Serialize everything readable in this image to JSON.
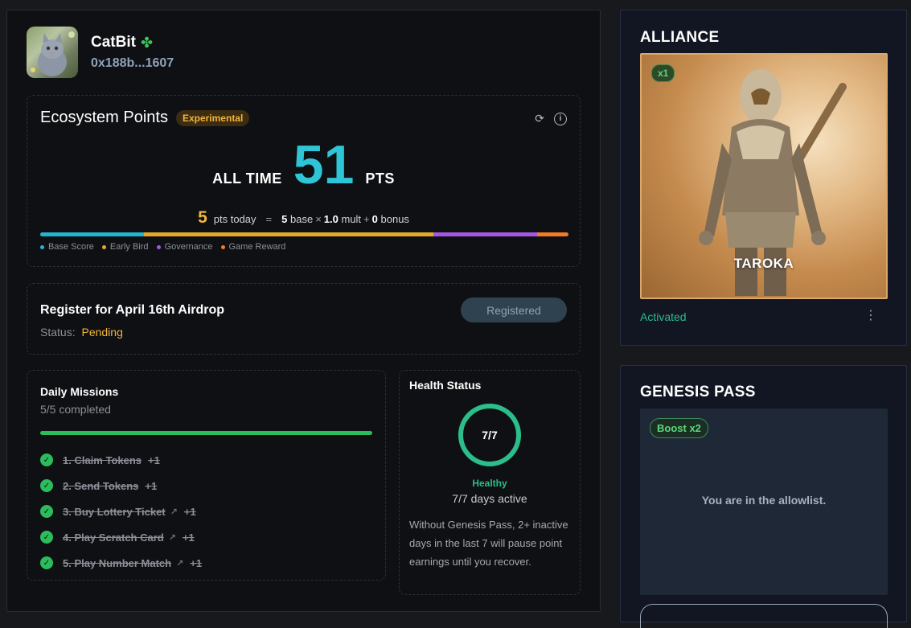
{
  "profile": {
    "name": "CatBit",
    "clover_icon": "four-leaf-clover-icon",
    "address": "0x188b...1607"
  },
  "ecosystem": {
    "title": "Ecosystem Points",
    "badge": "Experimental",
    "all_time_label": "ALL TIME",
    "all_time_value": "51",
    "pts_label": "PTS",
    "today_value": "5",
    "today_label": "pts today",
    "equals": "=",
    "base_value": "5",
    "base_label": "base",
    "times": "×",
    "mult_value": "1.0",
    "mult_label": "mult",
    "plus": "+",
    "bonus_value": "0",
    "bonus_label": "bonus",
    "bar_segments": [
      {
        "name": "Base Score",
        "color": "#22b6cf",
        "fraction": 0.196
      },
      {
        "name": "Early Bird",
        "color": "#e5a92e",
        "fraction": 0.549
      },
      {
        "name": "Governance",
        "color": "#a656e6",
        "fraction": 0.196
      },
      {
        "name": "Game Reward",
        "color": "#f27a2a",
        "fraction": 0.059
      }
    ],
    "legend": [
      {
        "label": "Base Score",
        "color": "#22b6cf"
      },
      {
        "label": "Early Bird",
        "color": "#e5a92e"
      },
      {
        "label": "Governance",
        "color": "#a656e6"
      },
      {
        "label": "Game Reward",
        "color": "#f27a2a"
      }
    ]
  },
  "airdrop": {
    "title": "Register for April 16th Airdrop",
    "status_label": "Status:",
    "status_value": "Pending",
    "button_label": "Registered"
  },
  "missions": {
    "title": "Daily Missions",
    "completed": "5/5 completed",
    "progress": 1.0,
    "items": [
      {
        "label": "1. Claim Tokens",
        "points": "+1",
        "external": false
      },
      {
        "label": "2. Send Tokens",
        "points": "+1",
        "external": false
      },
      {
        "label": "3. Buy Lottery Ticket",
        "points": "+1",
        "external": true
      },
      {
        "label": "4. Play Scratch Card",
        "points": "+1",
        "external": true
      },
      {
        "label": "5. Play Number Match",
        "points": "+1",
        "external": true
      }
    ]
  },
  "health": {
    "title": "Health Status",
    "ring_value": "7/7",
    "ring_fraction": 1.0,
    "status": "Healthy",
    "days_active": "7/7 days active",
    "note": "Without Genesis Pass, 2+ inactive days in the last 7 will pause point earnings until you recover."
  },
  "alliance": {
    "title": "ALLIANCE",
    "badge": "x1",
    "character_name": "TAROKA",
    "status": "Activated"
  },
  "genesis": {
    "title": "GENESIS PASS",
    "badge": "Boost x2",
    "message": "You are in the allowlist."
  }
}
